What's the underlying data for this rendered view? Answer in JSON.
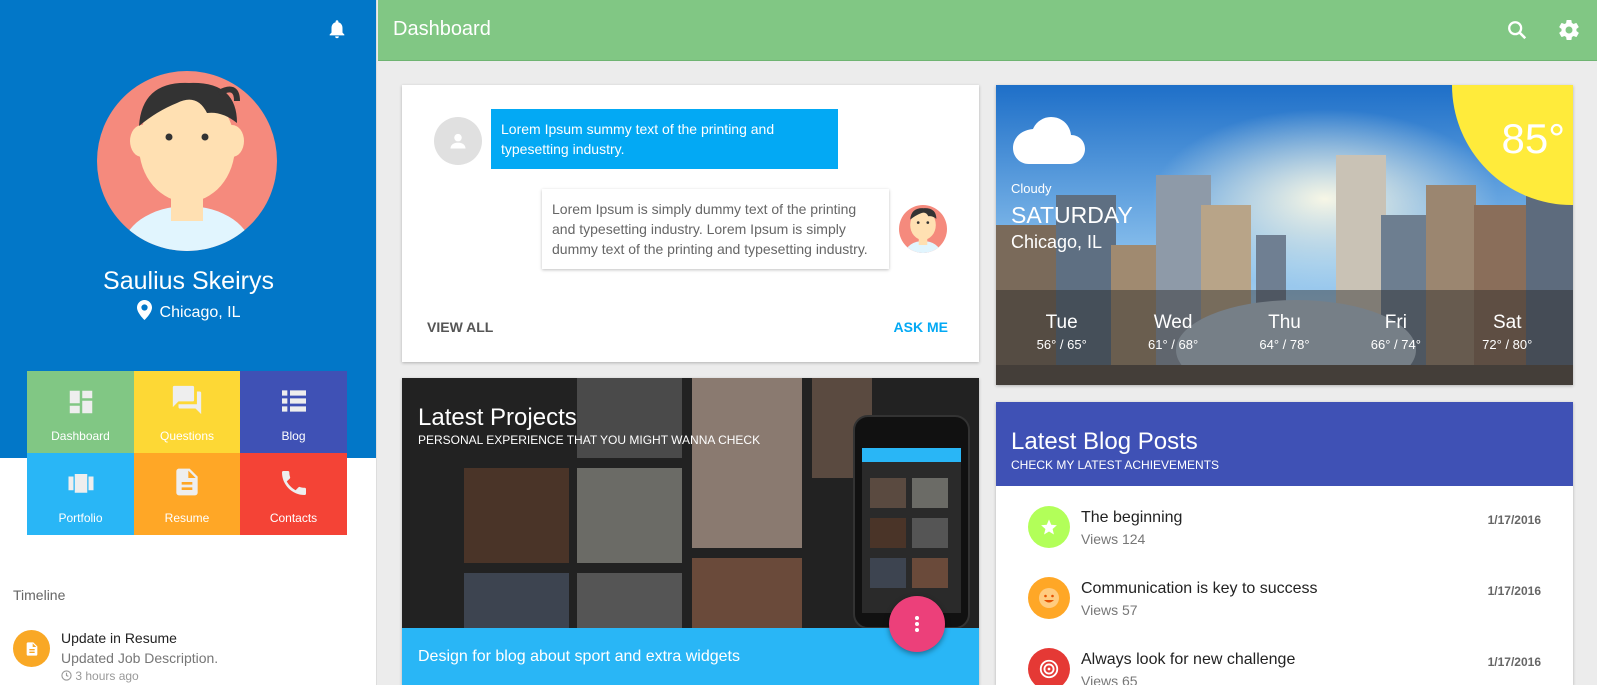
{
  "sidebar": {
    "user_name": "Saulius Skeirys",
    "user_location": "Chicago, IL",
    "tiles": [
      {
        "label": "Dashboard",
        "color": "#81c784"
      },
      {
        "label": "Questions",
        "color": "#fdd835"
      },
      {
        "label": "Blog",
        "color": "#3f51b5"
      },
      {
        "label": "Portfolio",
        "color": "#29b6f6"
      },
      {
        "label": "Resume",
        "color": "#ffa726"
      },
      {
        "label": "Contacts",
        "color": "#f44336"
      }
    ],
    "timeline": {
      "heading": "Timeline",
      "items": [
        {
          "title": "Update in Resume",
          "subtitle": "Updated Job Description.",
          "time": "3 hours ago"
        }
      ]
    }
  },
  "topbar": {
    "title": "Dashboard",
    "color": "#81c784"
  },
  "chat": {
    "message_in": "Lorem Ipsum summy text of the printing and typesetting industry.",
    "message_out": "Lorem Ipsum is simply dummy text of the printing and typesetting industry. Lorem Ipsum is simply dummy text of the printing and typesetting industry.",
    "view_all": "VIEW ALL",
    "ask_me": "ASK ME"
  },
  "weather": {
    "temperature": "85°",
    "condition": "Cloudy",
    "day": "SATURDAY",
    "city": "Chicago, IL",
    "forecast": [
      {
        "day": "Tue",
        "temps": "56° / 65°"
      },
      {
        "day": "Wed",
        "temps": "61° / 68°"
      },
      {
        "day": "Thu",
        "temps": "64° / 78°"
      },
      {
        "day": "Fri",
        "temps": "66° / 74°"
      },
      {
        "day": "Sat",
        "temps": "72° / 80°"
      }
    ]
  },
  "projects": {
    "title": "Latest Projects",
    "subtitle": "PERSONAL EXPERIENCE THAT YOU MIGHT WANNA CHECK",
    "caption": "Design for blog about sport and extra widgets"
  },
  "blog": {
    "title": "Latest Blog Posts",
    "subtitle": "CHECK MY LATEST ACHIEVEMENTS",
    "posts": [
      {
        "title": "The beginning",
        "views": "Views 124",
        "date": "1/17/2016",
        "icon": "star-icon",
        "color": "#b2ff59"
      },
      {
        "title": "Communication is key to success",
        "views": "Views 57",
        "date": "1/17/2016",
        "icon": "smile-icon",
        "color": "#ffa726"
      },
      {
        "title": "Always look for new challenge",
        "views": "Views 65",
        "date": "1/17/2016",
        "icon": "target-icon",
        "color": "#e53935"
      }
    ]
  }
}
